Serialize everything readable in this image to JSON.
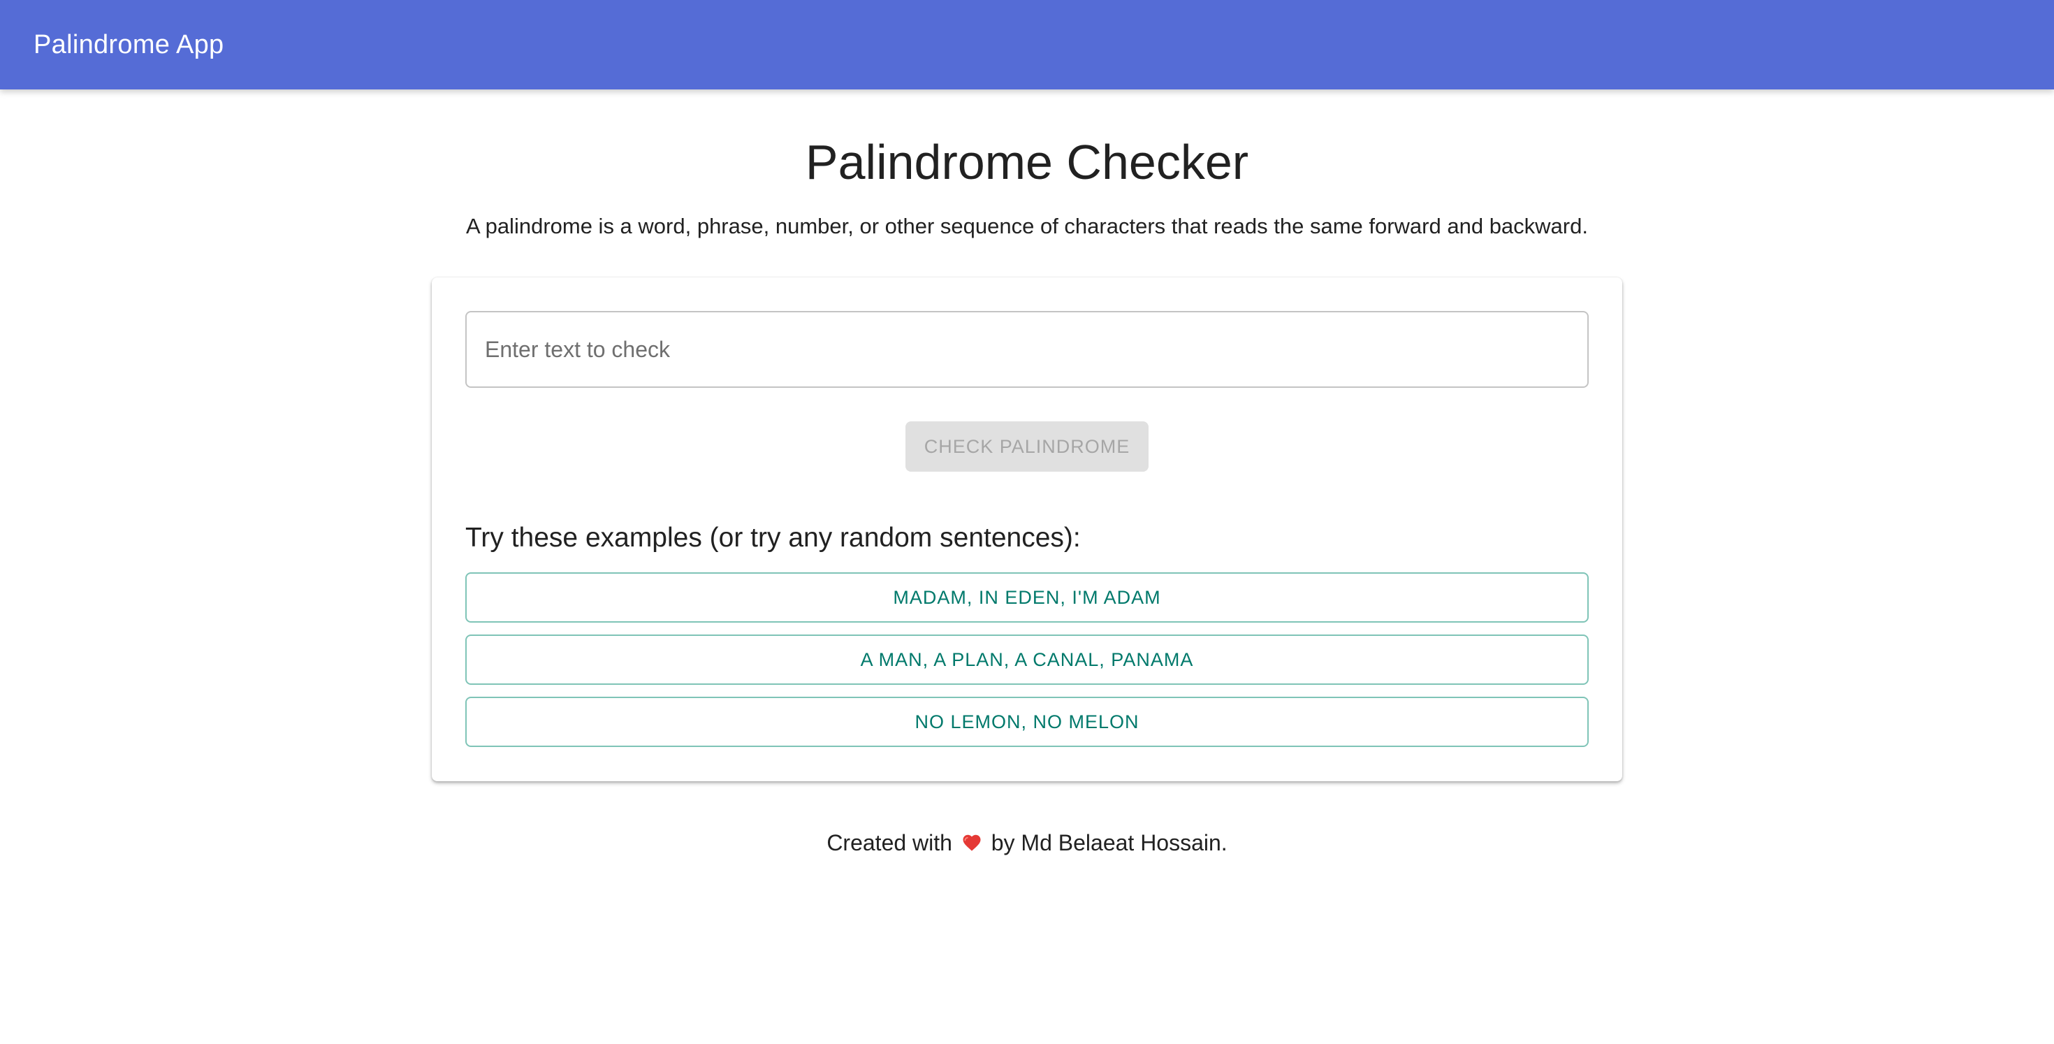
{
  "app_bar": {
    "title": "Palindrome App",
    "color": "#556cd6"
  },
  "main": {
    "title": "Palindrome Checker",
    "description": "A palindrome is a word, phrase, number, or other sequence of characters that reads the same forward and backward."
  },
  "form": {
    "input_placeholder": "Enter text to check",
    "input_value": "",
    "check_button_label": "Check Palindrome",
    "check_button_disabled": true
  },
  "examples": {
    "heading": "Try these examples (or try any random sentences):",
    "items": [
      {
        "label": "Madam, in Eden, I'm Adam"
      },
      {
        "label": "A man, a plan, a canal, Panama"
      },
      {
        "label": "No lemon, no melon"
      }
    ],
    "accent_color": "#00796b"
  },
  "footer": {
    "prefix": "Created with",
    "icon": "heart-icon",
    "suffix": "by Md Belaeat Hossain."
  }
}
